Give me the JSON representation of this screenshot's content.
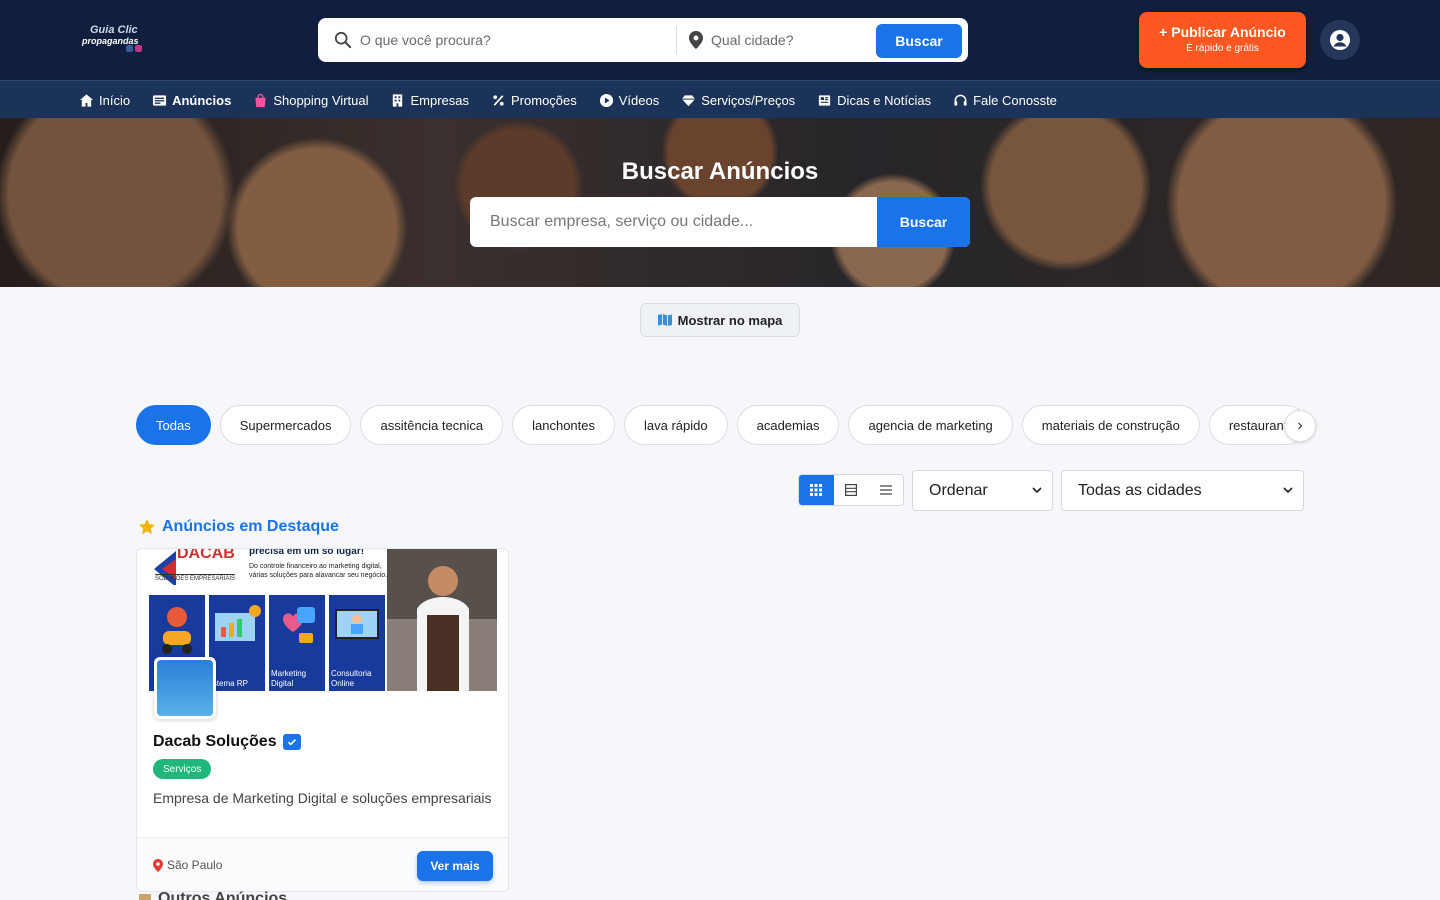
{
  "header": {
    "logo_line1": "Guia Clic",
    "logo_line2": "propagandas",
    "search_placeholder": "O que você procura?",
    "city_placeholder": "Qual cidade?",
    "search_button": "Buscar",
    "publish_title": "Publicar Anúncio",
    "publish_subtitle": "É rápido e grátis"
  },
  "nav": {
    "items": [
      {
        "label": "Início",
        "icon": "home-icon"
      },
      {
        "label": "Anúncios",
        "icon": "list-icon"
      },
      {
        "label": "Shopping Virtual",
        "icon": "shopping-bag-icon"
      },
      {
        "label": "Empresas",
        "icon": "building-icon"
      },
      {
        "label": "Promoções",
        "icon": "percent-icon"
      },
      {
        "label": "Vídeos",
        "icon": "play-icon"
      },
      {
        "label": "Serviços/Preços",
        "icon": "diamond-icon"
      },
      {
        "label": "Dicas e Notícias",
        "icon": "newspaper-icon"
      },
      {
        "label": "Fale Conosste",
        "icon": "headset-icon"
      }
    ]
  },
  "hero": {
    "title": "Buscar Anúncios",
    "search_placeholder": "Buscar empresa, serviço ou cidade...",
    "button": "Buscar"
  },
  "map_button": "Mostrar no mapa",
  "categories": [
    "Todas",
    "Supermercados",
    "assitência tecnica",
    "lanchontes",
    "lava rápido",
    "academias",
    "agencia de marketing",
    "materiais de construção",
    "restaurant"
  ],
  "filters": {
    "order": "Ordenar",
    "city": "Todas as cidades"
  },
  "featured": {
    "title": "Anúncios em Destaque",
    "card": {
      "banner_headline": "precisa em um só lugar!",
      "banner_text": "Do controle financeiro ao marketing digital, várias soluções para alavancar seu negócio.",
      "banner_brand": "DACAB",
      "banner_brand_sub": "SOLUÇÕES EMPRESARIAIS",
      "tiles": [
        "",
        "istema RP",
        "Marketing Digital",
        "Consultoria Online"
      ],
      "name": "Dacab Soluções",
      "tag": "Serviços",
      "description": "Empresa de Marketing Digital e soluções empresariais",
      "location": "São Paulo",
      "button": "Ver mais"
    }
  },
  "others_title": "Outros Anúncios",
  "colors": {
    "header_bg": "#0f1f3d",
    "nav_bg": "#1b3358",
    "primary": "#1a73e8",
    "accent": "#ff5722",
    "tag": "#20b87a"
  }
}
